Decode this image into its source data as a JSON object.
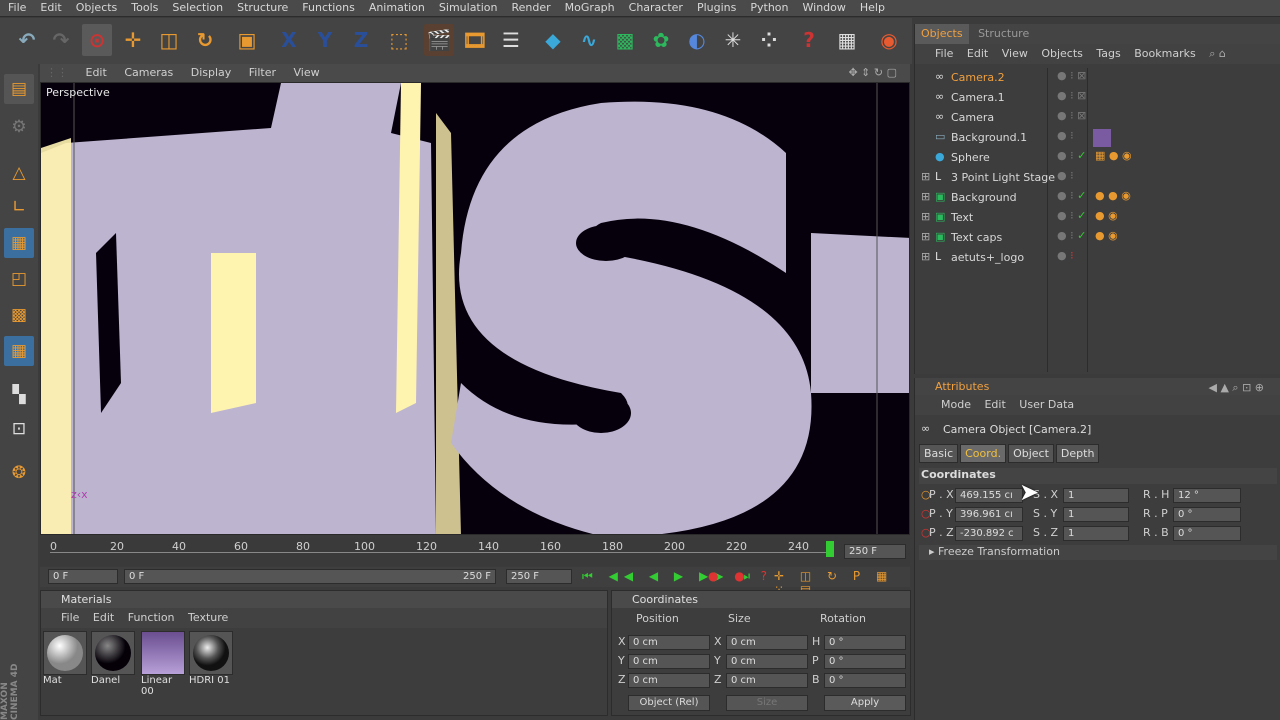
{
  "menubar": [
    "File",
    "Edit",
    "Objects",
    "Tools",
    "Selection",
    "Structure",
    "Functions",
    "Animation",
    "Simulation",
    "Render",
    "MoGraph",
    "Character",
    "Plugins",
    "Python",
    "Window",
    "Help"
  ],
  "toolbar": {
    "axes": [
      "X",
      "Y",
      "Z"
    ]
  },
  "viewport": {
    "menu": [
      "Edit",
      "Cameras",
      "Display",
      "Filter",
      "View"
    ],
    "label": "Perspective"
  },
  "timeline": {
    "ticks": [
      "0",
      "20",
      "40",
      "60",
      "80",
      "100",
      "120",
      "140",
      "160",
      "180",
      "200",
      "220",
      "240"
    ],
    "end_field": "250 F"
  },
  "transport": {
    "current": "0 F",
    "range_start": "0 F",
    "range_end": "250 F",
    "max": "250 F"
  },
  "materials": {
    "title": "Materials",
    "menu": [
      "File",
      "Edit",
      "Function",
      "Texture"
    ],
    "items": [
      "Mat",
      "Danel",
      "Linear 00",
      "HDRI 01"
    ]
  },
  "coords": {
    "title": "Coordinates",
    "headers": [
      "Position",
      "Size",
      "Rotation"
    ],
    "rows": [
      {
        "axis": "X",
        "pos": "0 cm",
        "saxis": "X",
        "size": "0 cm",
        "raxis": "H",
        "rot": "0 °"
      },
      {
        "axis": "Y",
        "pos": "0 cm",
        "saxis": "Y",
        "size": "0 cm",
        "raxis": "P",
        "rot": "0 °"
      },
      {
        "axis": "Z",
        "pos": "0 cm",
        "saxis": "Z",
        "size": "0 cm",
        "raxis": "B",
        "rot": "0 °"
      }
    ],
    "mode": "Object (Rel)",
    "size_mode": "Size",
    "apply": "Apply"
  },
  "objects": {
    "tabs": [
      "Objects",
      "Structure"
    ],
    "menu": [
      "File",
      "Edit",
      "View",
      "Objects",
      "Tags",
      "Bookmarks"
    ],
    "items": [
      "Camera.2",
      "Camera.1",
      "Camera",
      "Background.1",
      "Sphere",
      "3 Point Light Stage",
      "Background",
      "Text",
      "Text caps",
      "aetuts+_logo"
    ]
  },
  "attributes": {
    "title": "Attributes",
    "menu": [
      "Mode",
      "Edit",
      "User Data"
    ],
    "object": "Camera Object [Camera.2]",
    "tabs": [
      "Basic",
      "Coord.",
      "Object",
      "Depth"
    ],
    "section": "Coordinates",
    "rows": [
      {
        "p": "P . X",
        "pv": "469.155 cı",
        "s": "S . X",
        "sv": "1",
        "r": "R . H",
        "rv": "12 °"
      },
      {
        "p": "P . Y",
        "pv": "396.961 cı",
        "s": "S . Y",
        "sv": "1",
        "r": "R . P",
        "rv": "0 °"
      },
      {
        "p": "P . Z",
        "pv": "-230.892 c",
        "s": "S . Z",
        "sv": "1",
        "r": "R . B",
        "rv": "0 °"
      }
    ],
    "freeze": "Freeze Transformation"
  },
  "brand": "MAXON CINEMA 4D",
  "colors": {
    "accent": "#e89a30",
    "selected": "#f0a040",
    "text_face": "#bdb4d0",
    "highlight": "#fff3b0"
  }
}
